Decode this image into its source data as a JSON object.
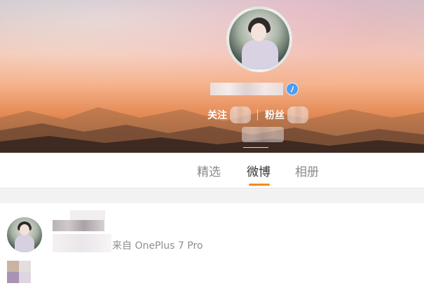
{
  "profile": {
    "verified_icon": "verified-v-icon",
    "stats": {
      "following_label": "关注",
      "followers_label": "粉丝"
    }
  },
  "tabs": [
    {
      "label": "精选",
      "active": false
    },
    {
      "label": "微博",
      "active": true
    },
    {
      "label": "相册",
      "active": false
    }
  ],
  "post": {
    "source": "来自 OnePlus 7 Pro"
  },
  "colors": {
    "tab_indicator": "#f28b1c",
    "verified_badge": "#4d9df0"
  }
}
